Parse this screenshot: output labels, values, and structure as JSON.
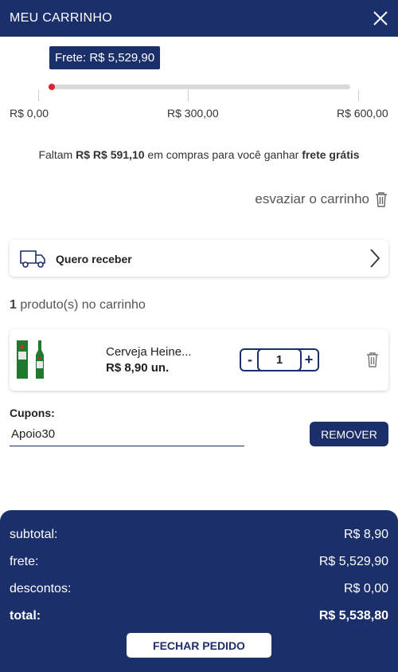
{
  "header": {
    "title": "MEU CARRINHO"
  },
  "freight": {
    "tooltip": "Frete: R$ 5,529,90",
    "progress_percent": 0,
    "ticks": [
      "R$ 0,00",
      "R$ 300,00",
      "R$ 600,00"
    ],
    "remaining_prefix": "Faltam",
    "remaining_amount": "R$ R$ 591,10",
    "remaining_middle": "em compras para você ganhar",
    "remaining_highlight": "frete grátis"
  },
  "cart": {
    "empty_label": "esvaziar o carrinho",
    "delivery_label": "Quero receber",
    "count": "1",
    "count_suffix": "produto(s) no carrinho"
  },
  "products": [
    {
      "name": "Cerveja Heine...",
      "price": "R$ 8,90 un.",
      "quantity": "1"
    }
  ],
  "coupon": {
    "label": "Cupons:",
    "value": "Apoio30",
    "remove_label": "REMOVER"
  },
  "summary": {
    "subtotal_label": "subtotal:",
    "subtotal_value": "R$ 8,90",
    "freight_label": "frete:",
    "freight_value": "R$ 5,529,90",
    "discount_label": "descontos:",
    "discount_value": "R$ 0,00",
    "total_label": "total:",
    "total_value": "R$ 5,538,80",
    "button_label": "FECHAR PEDIDO"
  },
  "colors": {
    "primary": "#1b2f6b",
    "progress": "#d7262d",
    "beer_green": "#1f7a2e"
  },
  "icons": [
    "close-icon",
    "trash-icon",
    "truck-icon",
    "chevron-right-icon",
    "beer-bottle-image"
  ]
}
